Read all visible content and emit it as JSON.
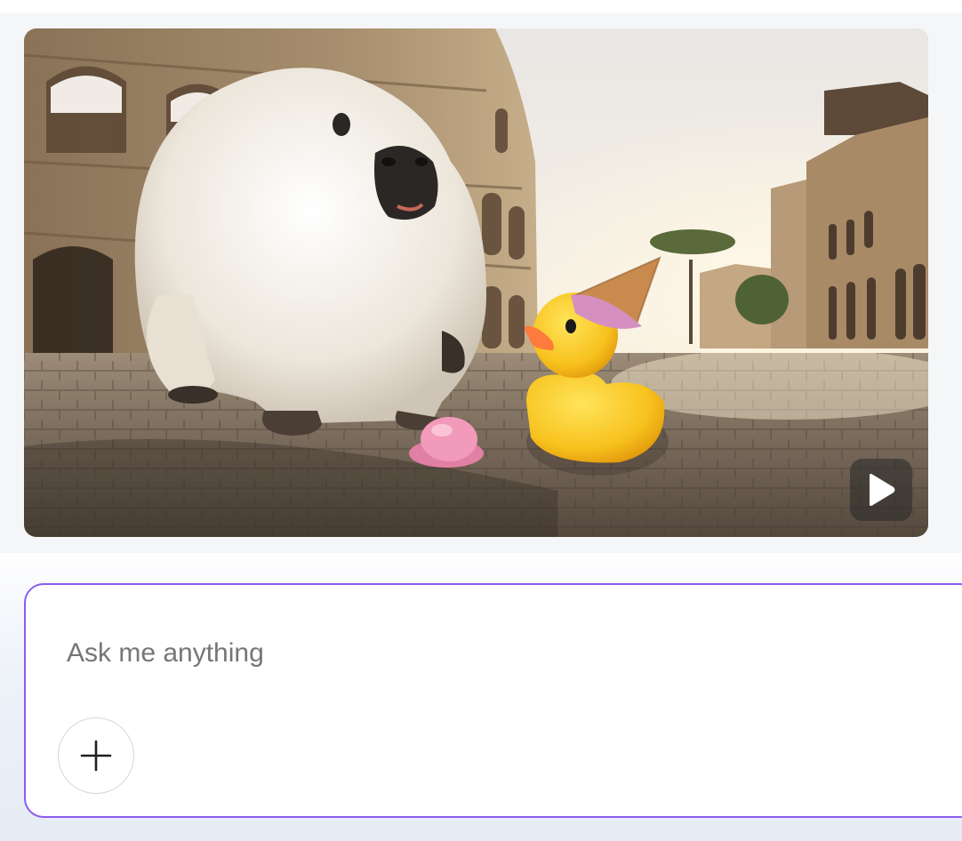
{
  "video": {
    "description_icon": "play-icon",
    "play_icon": "play-icon"
  },
  "prompt": {
    "placeholder": "Ask me anything",
    "value": "",
    "add_icon": "plus-icon"
  },
  "colors": {
    "accent_border": "#8a5cf0",
    "placeholder_text": "#767676",
    "background_top": "#f5f6f8"
  }
}
